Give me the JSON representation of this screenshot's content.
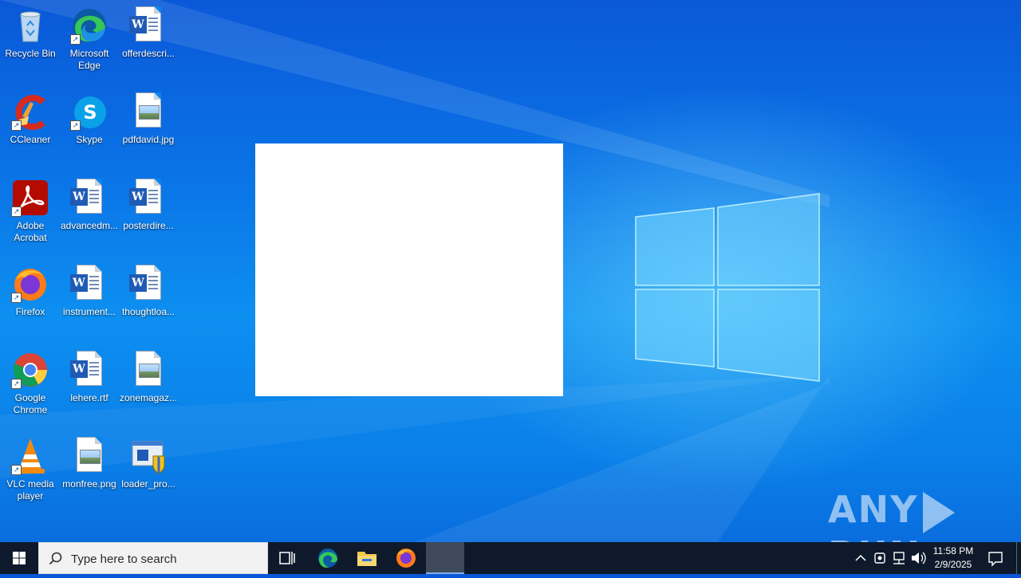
{
  "desktop": {
    "icons": [
      {
        "label": "Recycle Bin",
        "icon": "recycle-bin-icon"
      },
      {
        "label": "Microsoft Edge",
        "icon": "edge-icon"
      },
      {
        "label": "offerdescri...",
        "icon": "word-document-icon"
      },
      {
        "label": "CCleaner",
        "icon": "ccleaner-icon"
      },
      {
        "label": "Skype",
        "icon": "skype-icon"
      },
      {
        "label": "pdfdavid.jpg",
        "icon": "image-file-icon"
      },
      {
        "label": "Adobe Acrobat",
        "icon": "acrobat-icon"
      },
      {
        "label": "advancedm...",
        "icon": "word-document-icon"
      },
      {
        "label": "posterdire...",
        "icon": "word-document-icon"
      },
      {
        "label": "Firefox",
        "icon": "firefox-icon"
      },
      {
        "label": "instrument...",
        "icon": "word-document-icon"
      },
      {
        "label": "thoughtloa...",
        "icon": "word-document-icon"
      },
      {
        "label": "Google Chrome",
        "icon": "chrome-icon"
      },
      {
        "label": "lehere.rtf",
        "icon": "word-document-icon"
      },
      {
        "label": "zonemagaz...",
        "icon": "image-file-icon"
      },
      {
        "label": "VLC media player",
        "icon": "vlc-icon"
      },
      {
        "label": "monfree.png",
        "icon": "image-file-icon"
      },
      {
        "label": "loader_pro...",
        "icon": "installer-icon"
      }
    ]
  },
  "watermark": {
    "left": "ANY",
    "right": "RUN"
  },
  "taskbar": {
    "search_placeholder": "Type here to search",
    "pinned": [
      "task-view-icon",
      "edge-icon",
      "file-explorer-icon",
      "firefox-icon",
      "active-app-icon"
    ],
    "clock_time": "11:58 PM",
    "clock_date": "2/9/2025"
  },
  "colors": {
    "taskbar": "#0e1a2b",
    "desktop_accent": "#0b86ec"
  }
}
